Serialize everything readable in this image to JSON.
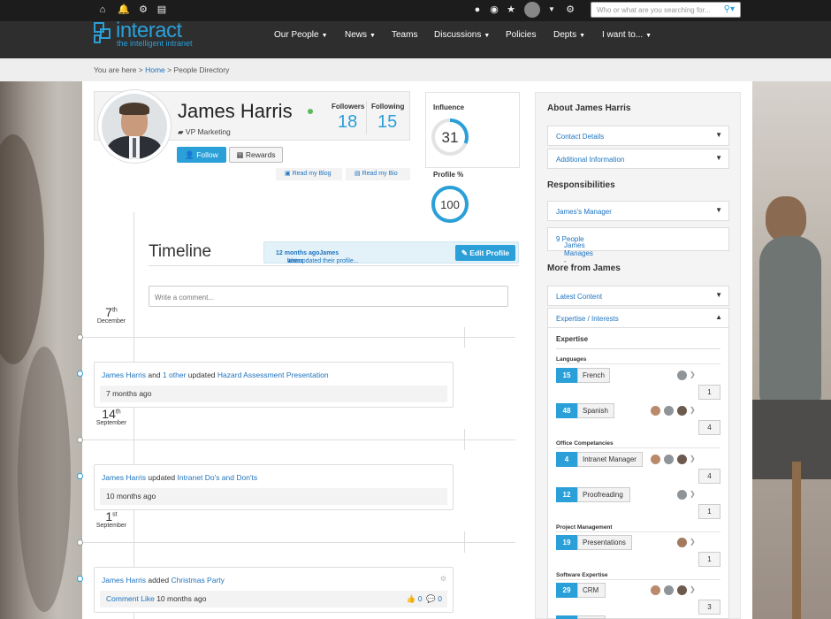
{
  "topbar": {
    "search_placeholder": "Who or what are you searching for...",
    "icons": [
      "home-icon",
      "bell-icon",
      "gear-icon",
      "document-icon",
      "alert-icon",
      "eye-icon",
      "star-icon",
      "chevron-down-icon",
      "gear-icon"
    ]
  },
  "brand": {
    "name": "interact",
    "tagline": "the intelligent intranet",
    "accent": "#2a9fd8"
  },
  "nav": {
    "items": [
      "Our People",
      "News",
      "Teams",
      "Discussions",
      "Policies",
      "Depts",
      "I want to..."
    ]
  },
  "breadcrumb": {
    "prefix": "You are here >",
    "home": "Home",
    "sep": ">",
    "current": "People Directory"
  },
  "profile": {
    "name": "James Harris",
    "title": "VP Marketing",
    "followers_label": "Followers",
    "followers": "18",
    "following_label": "Following",
    "following": "15",
    "follow_btn": "Follow",
    "rewards_btn": "Rewards",
    "blog_link": "Read my Blog",
    "bio_link": "Read my Bio",
    "influence_label": "Influence",
    "influence": "31",
    "influence_fraction": 0.31,
    "profile_label": "Profile %",
    "profile_pct": "100",
    "profile_fraction": 1.0
  },
  "timeline": {
    "title": "Timeline",
    "info_pre": "It was ",
    "info_ago": "12 months ago",
    "info_mid": " when ",
    "info_name": "James",
    "info_post": " last updated their profile...",
    "edit_btn": "Edit Profile",
    "comment_placeholder": "Write a comment...",
    "dates": [
      {
        "day": "7",
        "suffix": "th",
        "month": "December"
      },
      {
        "day": "14",
        "suffix": "th",
        "month": "September"
      },
      {
        "day": "1",
        "suffix": "st",
        "month": "September"
      }
    ],
    "items": [
      {
        "actor": "James Harris",
        "and": " and ",
        "others": "1 other",
        "verb": " updated ",
        "object": "Hazard Assessment Presentation",
        "ago": "7 months ago"
      },
      {
        "actor": "James Harris",
        "verb": " updated ",
        "object": "Intranet Do's and Don'ts",
        "ago": "10 months ago"
      },
      {
        "actor": "James Harris",
        "verb": " added ",
        "object": "Christmas Party",
        "comment": "Comment",
        "like": "Like",
        "ago": "10 months ago",
        "views": "0",
        "likes": "0"
      }
    ]
  },
  "sidebar": {
    "about_title": "About James Harris",
    "contact": "Contact Details",
    "additional": "Additional Information",
    "resp_title": "Responsibilities",
    "manager": "James's Manager",
    "manages_pre": "James Manages - ",
    "manages_link": "9 People",
    "more_title": "More from James",
    "latest": "Latest Content",
    "expertise_toggle": "Expertise / Interests",
    "expertise_title": "Expertise",
    "categories": [
      {
        "name": "Languages",
        "tags": [
          {
            "count": "15",
            "label": "French",
            "endorse": "1"
          },
          {
            "count": "48",
            "label": "Spanish",
            "endorse": "4"
          }
        ]
      },
      {
        "name": "Office Competancies",
        "tags": [
          {
            "count": "4",
            "label": "Intranet Manager",
            "endorse": "4"
          },
          {
            "count": "12",
            "label": "Proofreading",
            "endorse": "1"
          }
        ]
      },
      {
        "name": "Project Management",
        "tags": [
          {
            "count": "19",
            "label": "Presentations",
            "endorse": "1"
          }
        ]
      },
      {
        "name": "Software Expertise",
        "tags": [
          {
            "count": "29",
            "label": "CRM",
            "endorse": "3"
          }
        ]
      }
    ]
  }
}
